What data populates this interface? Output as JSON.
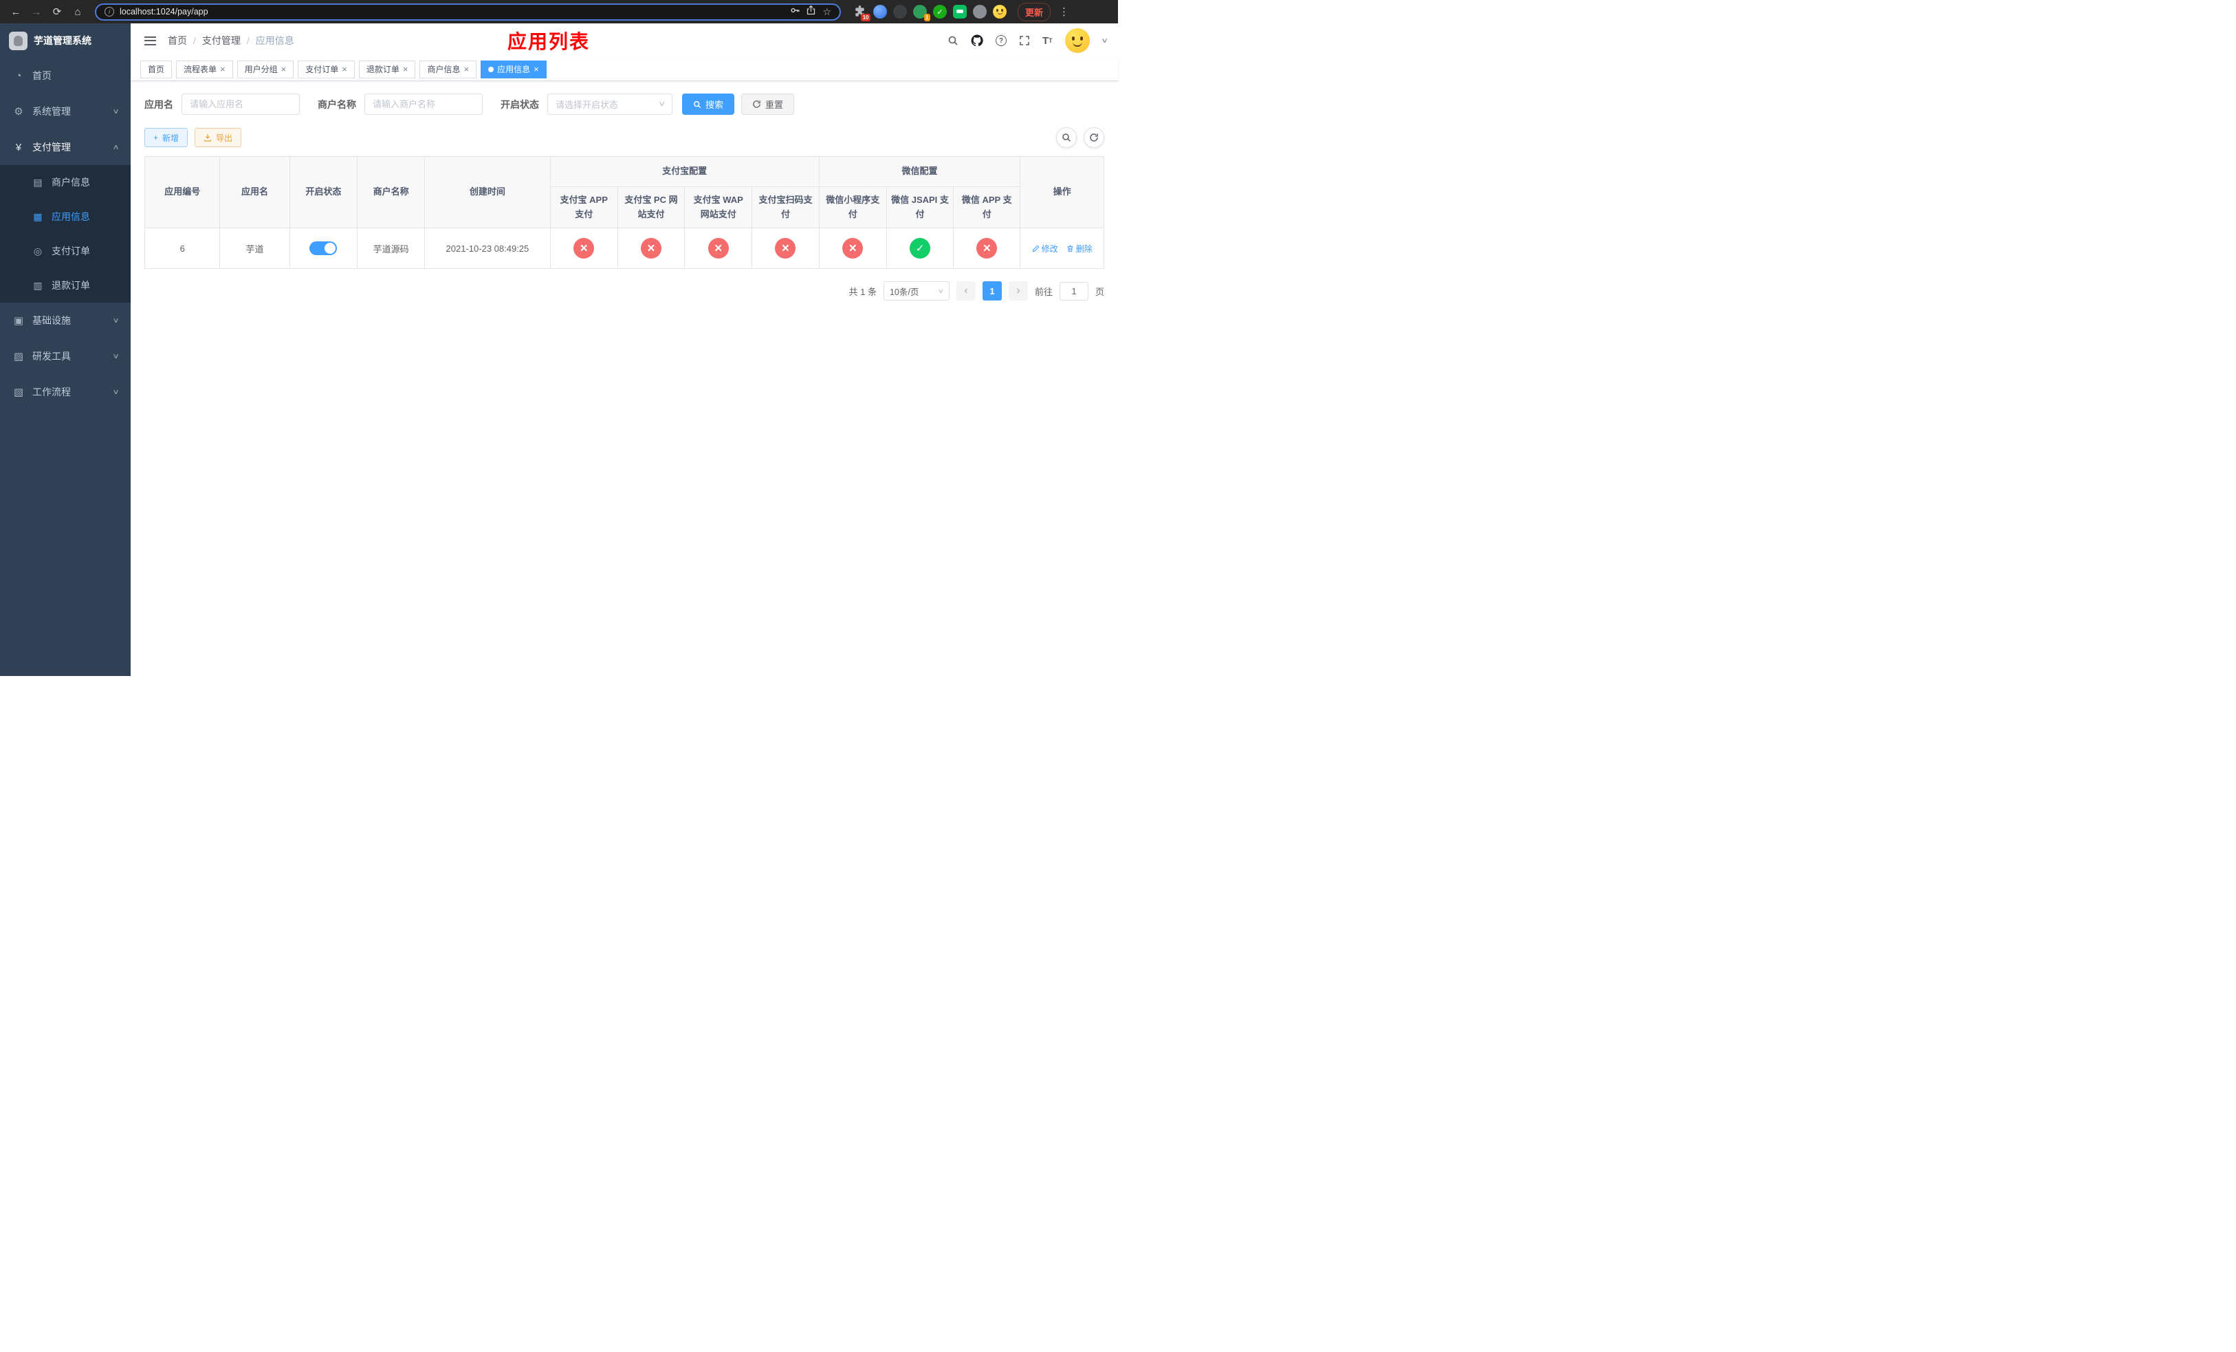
{
  "colors": {
    "accent": "#409eff",
    "success": "#13ce66",
    "danger": "#f56c6c",
    "warning": "#e6a23c",
    "annotation_red": "#ff0000",
    "sidebar_bg": "#304156",
    "submenu_bg": "#1f2d3d"
  },
  "browser": {
    "url": "localhost:1024/pay/app",
    "update_label": "更新",
    "extensions_badge": "10",
    "profile_badge": "1"
  },
  "sidebar": {
    "logo_title": "芋道管理系统",
    "menu": {
      "home": "首页",
      "system": "系统管理",
      "payment": "支付管理",
      "merchant_info": "商户信息",
      "app_info": "应用信息",
      "pay_order": "支付订单",
      "refund_order": "退款订单",
      "infrastructure": "基础设施",
      "dev_tools": "研发工具",
      "workflow": "工作流程"
    }
  },
  "navbar": {
    "breadcrumb": {
      "home": "首页",
      "section": "支付管理",
      "current": "应用信息"
    },
    "page_title": "应用列表"
  },
  "tabs": {
    "t0": "首页",
    "t1": "流程表单",
    "t2": "用户分组",
    "t3": "支付订单",
    "t4": "退款订单",
    "t5": "商户信息",
    "t6": "应用信息"
  },
  "filters": {
    "app_name_label": "应用名",
    "app_name_placeholder": "请输入应用名",
    "merchant_label": "商户名称",
    "merchant_placeholder": "请输入商户名称",
    "status_label": "开启状态",
    "status_placeholder": "请选择开启状态",
    "search_label": "搜索",
    "reset_label": "重置"
  },
  "toolbar": {
    "add_label": "新增",
    "export_label": "导出"
  },
  "table": {
    "headers": {
      "app_id": "应用编号",
      "app_name": "应用名",
      "status": "开启状态",
      "merchant": "商户名称",
      "create_time": "创建时间",
      "alipay_group": "支付宝配置",
      "wechat_group": "微信配置",
      "alipay_app": "支付宝 APP 支付",
      "alipay_pc": "支付宝 PC 网站支付",
      "alipay_wap": "支付宝 WAP 网站支付",
      "alipay_scan": "支付宝扫码支付",
      "wechat_lite": "微信小程序支付",
      "wechat_jsapi": "微信 JSAPI 支付",
      "wechat_app": "微信 APP 支付",
      "ops": "操作"
    },
    "row": {
      "app_id": "6",
      "app_name": "芋道",
      "toggle_state": "on",
      "merchant": "芋道源码",
      "create_time": "2021-10-23 08:49:25",
      "statuses": {
        "alipay_app": "x",
        "alipay_pc": "x",
        "alipay_wap": "x",
        "alipay_scan": "x",
        "wechat_lite": "x",
        "wechat_jsapi": "check",
        "wechat_app": "x"
      },
      "edit_label": "修改",
      "delete_label": "删除"
    }
  },
  "pagination": {
    "total": "共 1 条",
    "page_size": "10条/页",
    "page": "1",
    "goto_label": "前往",
    "goto_value": "1",
    "page_unit": "页"
  }
}
